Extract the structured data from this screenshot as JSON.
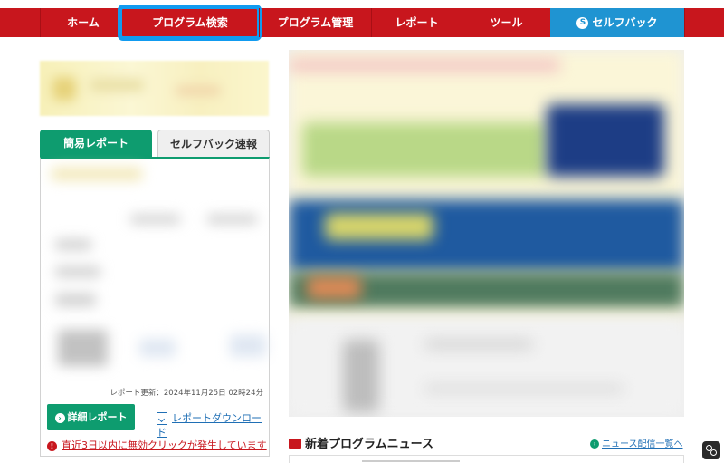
{
  "nav": {
    "home": "ホーム",
    "search": "プログラム検索",
    "manage": "プログラム管理",
    "report": "レポート",
    "tools": "ツール",
    "selfback": "セルフバック",
    "selfback_icon": "S"
  },
  "tabs": {
    "simple_report": "簡易レポート",
    "selfback_flash": "セルフバック速報"
  },
  "report": {
    "updated": "レポート更新：2024年11月25日 02時24分",
    "detail_button": "詳細レポート",
    "download_link": "レポートダウンロード",
    "warning": "直近3日以内に無効クリックが発生しています"
  },
  "news": {
    "title": "新着プログラムニュース",
    "list_link": "ニュース配信一覧へ"
  },
  "colors": {
    "nav_red": "#c8161d",
    "selfback_blue": "#1f94d2",
    "green": "#0e9c6f",
    "highlight": "#119bf0"
  }
}
